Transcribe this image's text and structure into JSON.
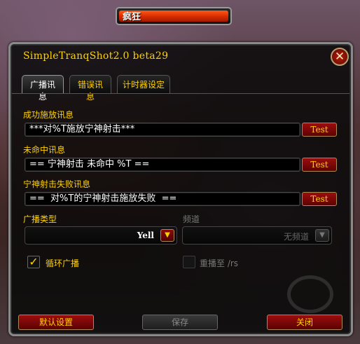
{
  "castbar": {
    "text": "疯狂"
  },
  "window": {
    "title": "SimpleTranqShot2.0 beta29",
    "close_glyph": "✕"
  },
  "tabs": [
    {
      "label": "广播讯息",
      "active": true
    },
    {
      "label": "错误讯息",
      "active": false
    },
    {
      "label": "计时器设定",
      "active": false
    }
  ],
  "messages": {
    "success": {
      "label": "成功施放讯息",
      "value": "***对%T施放宁神射击***",
      "test_label": "Test"
    },
    "miss": {
      "label": "未命中讯息",
      "value": "== 宁神射击 未命中 %T ==",
      "test_label": "Test"
    },
    "fail": {
      "label": "宁神射击失败讯息",
      "value": "==  对%T的宁神射击施放失败  ==",
      "test_label": "Test"
    }
  },
  "broadcast_type": {
    "label": "广播类型",
    "value": "Yell"
  },
  "channel": {
    "label": "频道",
    "value": "无频道",
    "enabled": false
  },
  "loop_broadcast": {
    "label": "循环广播",
    "checked": true
  },
  "rebroadcast": {
    "label": "重播至 /rs",
    "checked": false,
    "enabled": false
  },
  "buttons": {
    "defaults": "默认设置",
    "save": "保存",
    "close": "关闭"
  },
  "colors": {
    "accent_gold": "#ffd100",
    "button_red": "#9c0d0d",
    "castbar_orange": "#ff5a1a"
  }
}
